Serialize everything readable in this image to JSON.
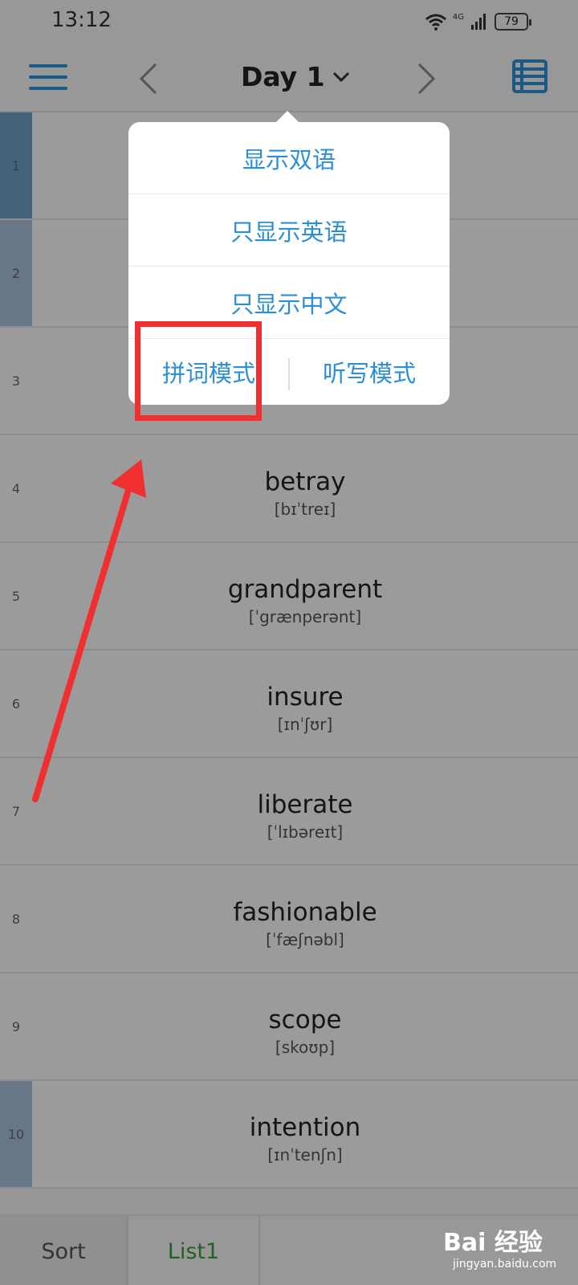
{
  "status_bar": {
    "time": "13:12",
    "network": "4G",
    "battery": "79"
  },
  "header": {
    "title": "Day 1",
    "chevron": "chevron-down-icon"
  },
  "words": [
    {
      "index": "1",
      "word": "",
      "phonetic": ""
    },
    {
      "index": "2",
      "word": "",
      "phonetic": ""
    },
    {
      "index": "3",
      "word": "",
      "phonetic": ""
    },
    {
      "index": "4",
      "word": "betray",
      "phonetic": "[bɪˈtreɪ]"
    },
    {
      "index": "5",
      "word": "grandparent",
      "phonetic": "[ˈgrænperənt]"
    },
    {
      "index": "6",
      "word": "insure",
      "phonetic": "[ɪnˈʃʊr]"
    },
    {
      "index": "7",
      "word": "liberate",
      "phonetic": "[ˈlɪbəreɪt]"
    },
    {
      "index": "8",
      "word": "fashionable",
      "phonetic": "[ˈfæʃnəbl]"
    },
    {
      "index": "9",
      "word": "scope",
      "phonetic": "[skoʊp]"
    },
    {
      "index": "10",
      "word": "intention",
      "phonetic": "[ɪnˈtenʃn]"
    }
  ],
  "popup": {
    "show_bilingual": "显示双语",
    "show_english_only": "只显示英语",
    "show_chinese_only": "只显示中文",
    "spelling_mode": "拼词模式",
    "dictation_mode": "听写模式"
  },
  "bottom_tabs": {
    "sort": "Sort",
    "list1": "List1"
  },
  "watermark": {
    "logo": "Bai 经验",
    "sub": "jingyan.baidu.com"
  },
  "colors": {
    "accent": "#2a8fd8",
    "annotation": "#f03030",
    "tab_active": "#3c9b3c"
  }
}
